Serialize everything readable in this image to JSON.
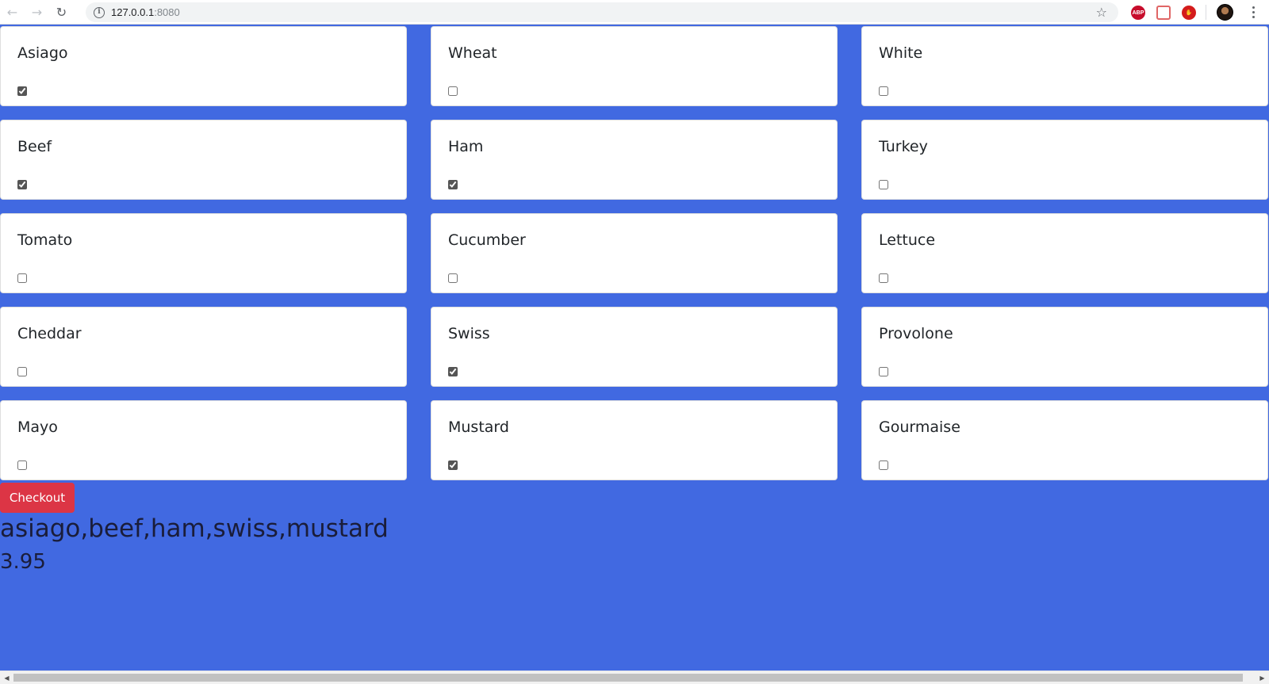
{
  "browser": {
    "url_host": "127.0.0.1",
    "url_port": ":8080",
    "extensions": [
      "abp-icon",
      "pdf-icon",
      "stop-icon"
    ],
    "abp_label": "ABP"
  },
  "items": [
    {
      "label": "Asiago",
      "checked": true
    },
    {
      "label": "Wheat",
      "checked": false
    },
    {
      "label": "White",
      "checked": false
    },
    {
      "label": "Beef",
      "checked": true
    },
    {
      "label": "Ham",
      "checked": true
    },
    {
      "label": "Turkey",
      "checked": false
    },
    {
      "label": "Tomato",
      "checked": false
    },
    {
      "label": "Cucumber",
      "checked": false
    },
    {
      "label": "Lettuce",
      "checked": false
    },
    {
      "label": "Cheddar",
      "checked": false
    },
    {
      "label": "Swiss",
      "checked": true
    },
    {
      "label": "Provolone",
      "checked": false
    },
    {
      "label": "Mayo",
      "checked": false
    },
    {
      "label": "Mustard",
      "checked": true
    },
    {
      "label": "Gourmaise",
      "checked": false
    }
  ],
  "checkout_label": "Checkout",
  "selection_text": "asiago,beef,ham,swiss,mustard",
  "price_text": "3.95",
  "colors": {
    "background": "#4169e1",
    "checkout": "#dc3545"
  }
}
